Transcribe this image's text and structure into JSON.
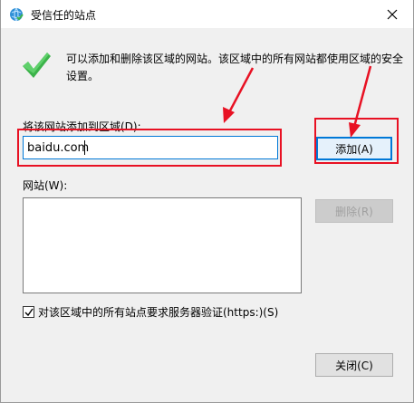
{
  "window": {
    "title": "受信任的站点",
    "info_text": "可以添加和删除该区域的网站。该区域中的所有网站都使用区域的安全设置。"
  },
  "add_site": {
    "label": "将该网站添加到区域(D):",
    "input_value": "baidu.com",
    "add_button": "添加(A)"
  },
  "sites": {
    "label": "网站(W):",
    "items": [],
    "delete_button": "删除(R)"
  },
  "https_check": {
    "label": "对该区域中的所有站点要求服务器验证(https:)(S)",
    "checked": true
  },
  "footer": {
    "close_button": "关闭(C)"
  },
  "colors": {
    "accent": "#0078d7",
    "highlight": "#e81123",
    "check_green": "#3cb34a"
  }
}
